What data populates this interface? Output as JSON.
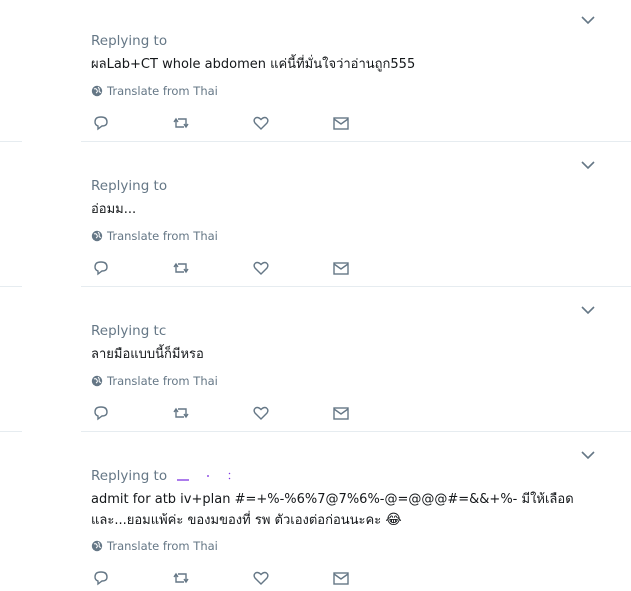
{
  "replies": [
    {
      "replying_label": "Replying to",
      "text": "ผลLab+CT whole abdomen แค่นี้ที่มั่นใจว่าอ่านถูก555",
      "translate_label": "Translate from Thai"
    },
    {
      "replying_label": "Replying to",
      "text": "อ่อมม...",
      "translate_label": "Translate from Thai"
    },
    {
      "replying_label": "Replying tc",
      "text": "ลายมือแบบนี้ก็มีหรอ",
      "translate_label": "Translate from Thai"
    },
    {
      "replying_label": "Replying to",
      "text_line1": "admit for atb iv+plan #=+%-%6%7@7%6%-@=@@@#=&&+%- มีให้เลือด",
      "text_line2": "และ...ยอมแพ้ค่ะ ของมของที่ รพ ตัวเองต่อก่อนนะคะ",
      "emoji": "😂",
      "translate_label": "Translate from Thai"
    }
  ],
  "icons": {
    "reply": "reply-icon",
    "retweet": "retweet-icon",
    "like": "heart-icon",
    "dm": "mail-icon",
    "caret": "chevron-down-icon",
    "globe": "globe-icon"
  },
  "colors": {
    "secondary_text": "#657786",
    "divider": "#e6ecf0",
    "icon": "#657786"
  }
}
